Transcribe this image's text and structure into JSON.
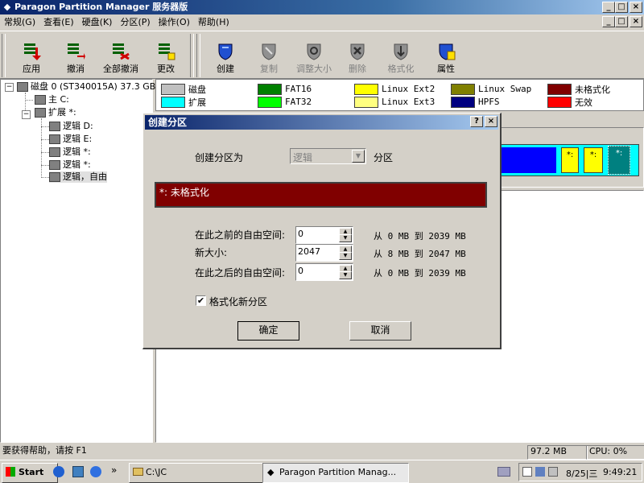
{
  "window": {
    "title": "Paragon Partition Manager 服务器版",
    "min_symbol": "_",
    "max_symbol": "□",
    "close_symbol": "×"
  },
  "menu": [
    {
      "label": "常规(G)"
    },
    {
      "label": "查看(E)"
    },
    {
      "label": "硬盘(K)"
    },
    {
      "label": "分区(P)"
    },
    {
      "label": "操作(O)"
    },
    {
      "label": "帮助(H)"
    }
  ],
  "toolbar": {
    "apply": "应用",
    "undo": "撤消",
    "undo_all": "全部撤消",
    "change": "更改",
    "create": "创建",
    "copy": "复制",
    "resize": "调整大小",
    "delete": "删除",
    "format": "格式化",
    "properties": "属性"
  },
  "tree": {
    "disk": "磁盘 0 (ST340015A) 37.3 GB",
    "primary": "主 C:",
    "extended": "扩展 *:",
    "logical_d": "逻辑 D:",
    "logical_e": "逻辑 E:",
    "logical_s1": "逻辑 *:",
    "logical_s2": "逻辑 *:",
    "logical_free": "逻辑，自由"
  },
  "legend": [
    {
      "label": "磁盘",
      "color": "#c0c0c0"
    },
    {
      "label": "扩展",
      "color": "#00ffff"
    },
    {
      "label": "FAT16",
      "color": "#008000"
    },
    {
      "label": "FAT32",
      "color": "#00ff00"
    },
    {
      "label": "Linux Ext2",
      "color": "#ffff00"
    },
    {
      "label": "Linux Ext3",
      "color": "#ffff80"
    },
    {
      "label": "Linux Swap",
      "color": "#808000"
    },
    {
      "label": "HPFS",
      "color": "#000080"
    },
    {
      "label": "未格式化",
      "color": "#800000"
    },
    {
      "label": "无效",
      "color": "#ff0000"
    }
  ],
  "disk_map": {
    "seg1": "*:",
    "seg2": "*:",
    "seg3": "*:"
  },
  "dialog": {
    "title": "创建分区",
    "help_symbol": "?",
    "close_symbol": "×",
    "create_as_label": "创建分区为",
    "create_as_value": "逻辑",
    "partition_suffix": "分区",
    "preview_label": "*: 未格式化",
    "free_before_label": "在此之前的自由空间:",
    "free_before_value": "0",
    "free_before_range": "从 0 MB 到 2039 MB",
    "new_size_label": "新大小:",
    "new_size_value": "2047",
    "new_size_range": "从 8 MB 到 2047 MB",
    "free_after_label": "在此之后的自由空间:",
    "free_after_value": "0",
    "free_after_range": "从 0 MB 到 2039 MB",
    "format_label": "格式化新分区",
    "format_checked": true,
    "ok": "确定",
    "cancel": "取消"
  },
  "status": {
    "help": "要获得帮助，请按 F1",
    "memory": "97.2 MB",
    "cpu": "CPU: 0%"
  },
  "taskbar": {
    "start": "Start",
    "quick_more": "»",
    "task1": "C:\\JC",
    "task2": "Paragon Partition Manag...",
    "date": "8/25|三",
    "time": "9:49:21"
  }
}
